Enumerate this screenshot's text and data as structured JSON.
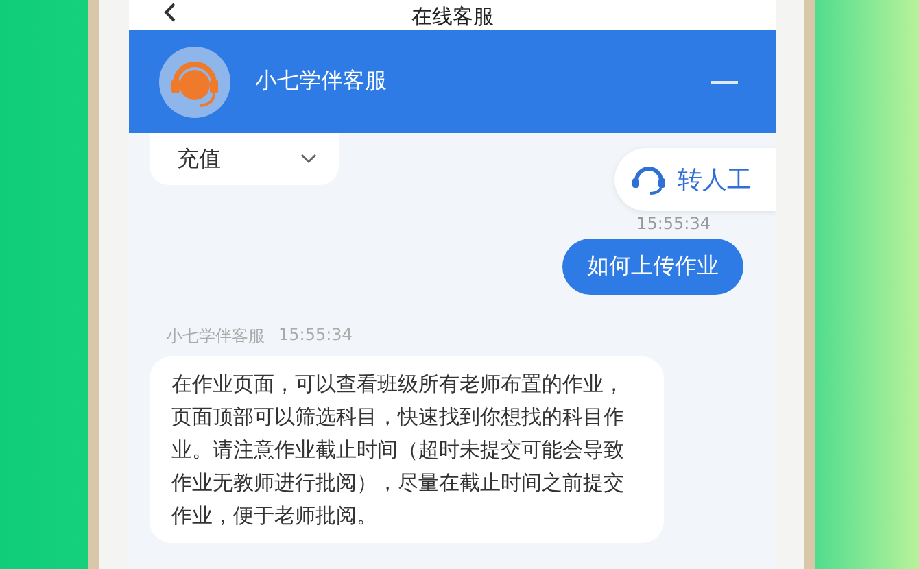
{
  "window": {
    "title": "在线客服"
  },
  "header": {
    "agent_name": "小七学伴客服"
  },
  "category_selector": {
    "value": "充值"
  },
  "transfer_button": {
    "label": "转人工"
  },
  "messages": [
    {
      "kind": "outgoing",
      "time": "15:55:34",
      "text": "如何上传作业"
    },
    {
      "kind": "incoming",
      "sender": "小七学伴客服",
      "time": "15:55:34",
      "text": "在作业页面，可以查看班级所有老师布置的作业，页面顶部可以筛选科目，快速找到你想找的科目作业。请注意作业截止时间（超时未提交可能会导致作业无教师进行批阅），尽量在截止时间之前提交作业，便于老师批阅。"
    }
  ]
}
